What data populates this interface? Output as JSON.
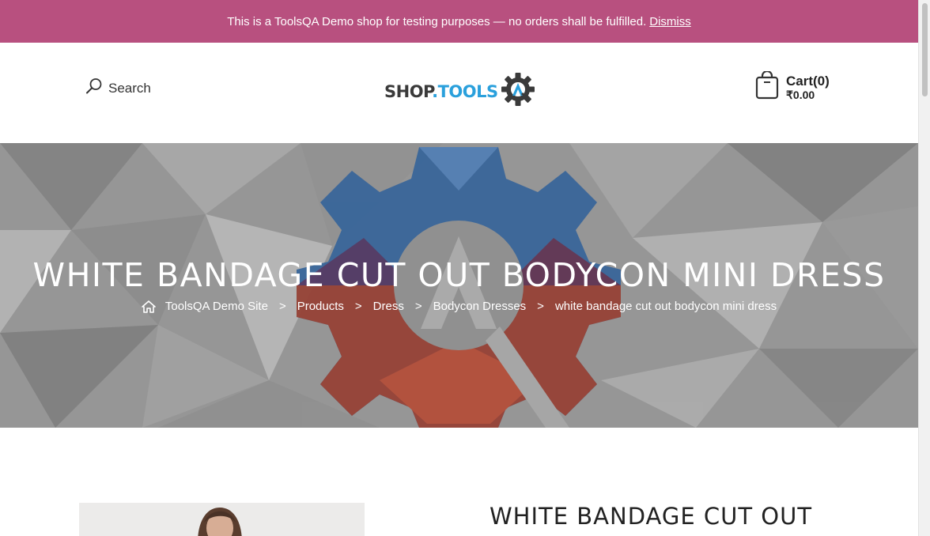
{
  "notice": {
    "message": "This is a ToolsQA Demo shop for testing purposes — no orders shall be fulfilled.",
    "dismiss_label": "Dismiss"
  },
  "header": {
    "search_label": "Search",
    "logo": {
      "part1": "SHOP",
      "part2": ".TOOLS",
      "icon": "toolsqa-gear-logo"
    },
    "cart": {
      "label": "Cart(0)",
      "total": "₹0.00",
      "icon": "shopping-bag-icon"
    }
  },
  "hero": {
    "title": "WHITE BANDAGE CUT OUT BODYCON MINI DRESS",
    "breadcrumb": [
      {
        "label": "ToolsQA Demo Site"
      },
      {
        "label": "Products"
      },
      {
        "label": "Dress"
      },
      {
        "label": "Bodycon Dresses"
      },
      {
        "label": "white bandage cut out bodycon mini dress"
      }
    ],
    "separator": ">"
  },
  "product": {
    "title": "WHITE BANDAGE CUT OUT"
  },
  "colors": {
    "notice_bg": "#b8507f",
    "accent_blue": "#2aa0dc"
  }
}
